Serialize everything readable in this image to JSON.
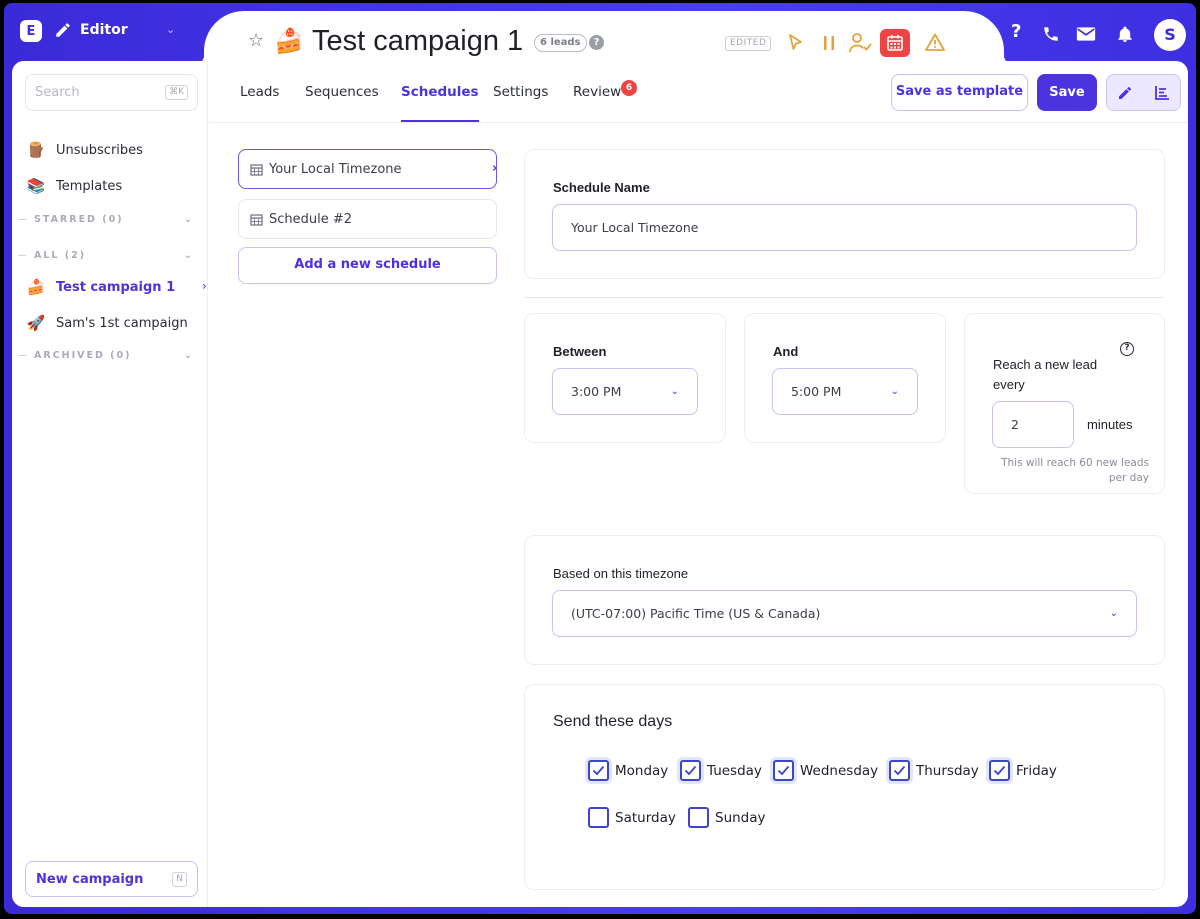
{
  "app": {
    "logo_letter": "E",
    "mode_label": "Editor",
    "avatar_initial": "S"
  },
  "campaign": {
    "emoji": "🍰",
    "title": "Test campaign 1",
    "leads_badge": "6 leads",
    "status_pill": "EDITED"
  },
  "sidebar": {
    "search_placeholder": "Search",
    "search_shortcut": "⌘K",
    "items": [
      {
        "emoji": "🪵",
        "label": "Unsubscribes"
      },
      {
        "emoji": "📚",
        "label": "Templates"
      }
    ],
    "sections": {
      "starred": "STARRED (0)",
      "all": "ALL (2)",
      "archived": "ARCHIVED (0)"
    },
    "campaigns": [
      {
        "emoji": "🍰",
        "label": "Test campaign 1",
        "active": true
      },
      {
        "emoji": "🚀",
        "label": "Sam's 1st campaign",
        "active": false
      }
    ],
    "new_campaign_label": "New campaign",
    "new_campaign_shortcut": "N"
  },
  "tabs": {
    "items": [
      "Leads",
      "Sequences",
      "Schedules",
      "Settings",
      "Review"
    ],
    "active": "Schedules",
    "review_badge": "6",
    "save_template_label": "Save as template",
    "save_label": "Save"
  },
  "schedules": {
    "list": [
      "Your Local Timezone",
      "Schedule #2"
    ],
    "selected": "Your Local Timezone",
    "add_label": "Add a new schedule"
  },
  "form": {
    "name_label": "Schedule Name",
    "name_value": "Your Local Timezone",
    "between_label": "Between",
    "between_value": "3:00 PM",
    "and_label": "And",
    "and_value": "5:00 PM",
    "reach_label_line1": "Reach a new lead",
    "reach_label_line2": "every",
    "reach_value": "2",
    "reach_unit": "minutes",
    "reach_hint_line1": "This will reach 60 new leads",
    "reach_hint_line2": "per day",
    "timezone_label": "Based on this timezone",
    "timezone_value": "(UTC-07:00) Pacific Time (US & Canada)",
    "days_title": "Send these days",
    "days": [
      {
        "label": "Monday",
        "checked": true
      },
      {
        "label": "Tuesday",
        "checked": true
      },
      {
        "label": "Wednesday",
        "checked": true
      },
      {
        "label": "Thursday",
        "checked": true
      },
      {
        "label": "Friday",
        "checked": true
      },
      {
        "label": "Saturday",
        "checked": false
      },
      {
        "label": "Sunday",
        "checked": false
      }
    ]
  },
  "colors": {
    "accent": "#4b33e0",
    "frame": "#3a2ad8",
    "alert": "#ef4444",
    "warning": "#e5a23a"
  },
  "icons": [
    "star-icon",
    "help-icon",
    "cursor-icon",
    "pause-icon",
    "user-check-icon",
    "calendar-icon",
    "warning-icon",
    "phone-icon",
    "mail-icon",
    "bell-icon",
    "pencil-icon",
    "chart-icon",
    "chevron-down-icon"
  ]
}
